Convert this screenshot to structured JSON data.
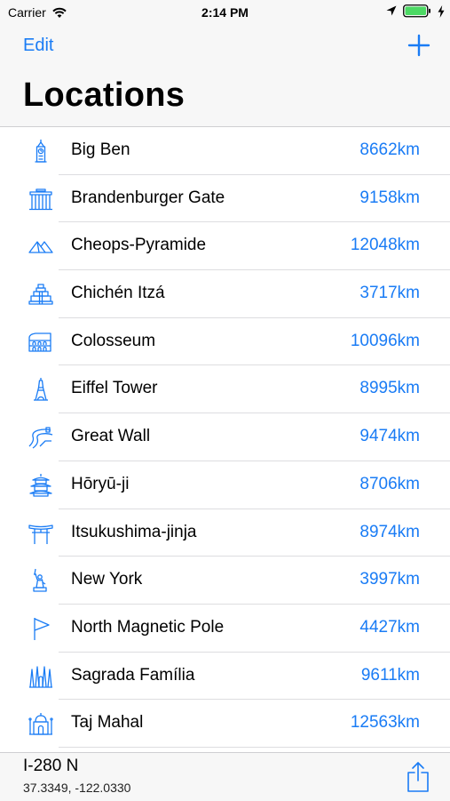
{
  "status_bar": {
    "carrier": "Carrier",
    "time": "2:14 PM"
  },
  "nav": {
    "edit_label": "Edit",
    "title": "Locations",
    "add_icon": "plus-icon"
  },
  "locations": [
    {
      "name": "Big Ben",
      "distance": "8662km",
      "icon": "big-ben-icon"
    },
    {
      "name": "Brandenburger Gate",
      "distance": "9158km",
      "icon": "brandenburg-gate-icon"
    },
    {
      "name": "Cheops-Pyramide",
      "distance": "12048km",
      "icon": "pyramid-icon"
    },
    {
      "name": "Chichén Itzá",
      "distance": "3717km",
      "icon": "mayan-temple-icon"
    },
    {
      "name": "Colosseum",
      "distance": "10096km",
      "icon": "colosseum-icon"
    },
    {
      "name": "Eiffel Tower",
      "distance": "8995km",
      "icon": "eiffel-tower-icon"
    },
    {
      "name": "Great Wall",
      "distance": "9474km",
      "icon": "great-wall-icon"
    },
    {
      "name": "Hōryū-ji",
      "distance": "8706km",
      "icon": "pagoda-icon"
    },
    {
      "name": "Itsukushima-jinja",
      "distance": "8974km",
      "icon": "torii-gate-icon"
    },
    {
      "name": "New York",
      "distance": "3997km",
      "icon": "statue-of-liberty-icon"
    },
    {
      "name": "North Magnetic Pole",
      "distance": "4427km",
      "icon": "flag-icon"
    },
    {
      "name": "Sagrada Família",
      "distance": "9611km",
      "icon": "sagrada-familia-icon"
    },
    {
      "name": "Taj Mahal",
      "distance": "12563km",
      "icon": "taj-mahal-icon"
    }
  ],
  "toolbar": {
    "road": "I-280 N",
    "coordinates": "37.3349, -122.0330",
    "share_icon": "share-icon"
  },
  "colors": {
    "accent": "#1a7cf5",
    "battery": "#4cd964"
  }
}
